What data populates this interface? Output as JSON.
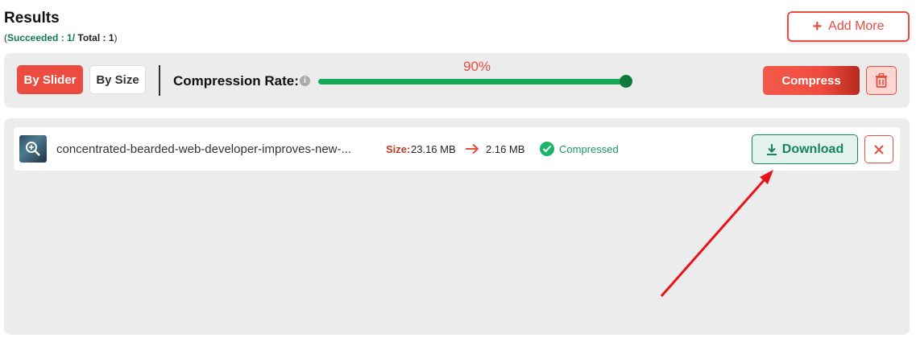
{
  "header": {
    "title": "Results",
    "stats_open": "(",
    "succeeded": "Succeeded : 1",
    "separator": "/",
    "total": " Total : 1",
    "stats_close": ")"
  },
  "add_more": {
    "icon": "plus-icon",
    "label": "Add More"
  },
  "toolbar": {
    "mode_slider": "By Slider",
    "mode_size": "By Size",
    "active_mode": "By Slider",
    "rate_label": "Compression Rate:",
    "rate_value_text": "90%",
    "rate_fraction": 0.99,
    "compress_label": "Compress",
    "trash_icon": "trash-icon"
  },
  "file": {
    "name": "concentrated-bearded-web-developer-improves-new-...",
    "size_label": "Size:",
    "size_before": "23.16 MB",
    "size_after": "2.16 MB",
    "status": "Compressed",
    "download_label": "Download",
    "remove_icon": "close-icon"
  },
  "colors": {
    "accent_red": "#e34d42",
    "accent_green": "#16855a",
    "panel_bg": "#ececec"
  }
}
